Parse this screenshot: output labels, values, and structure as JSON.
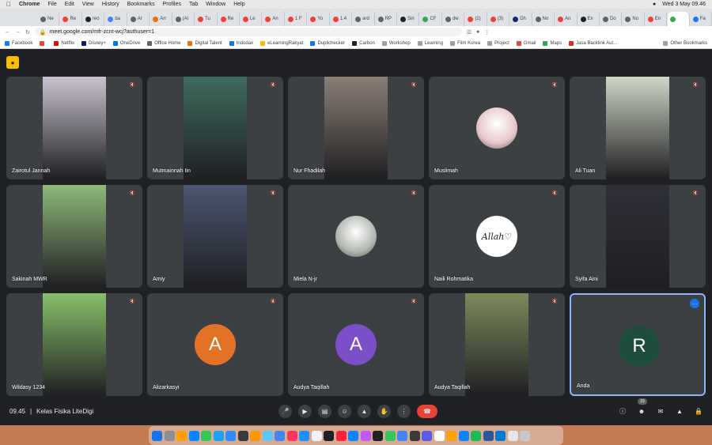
{
  "macos": {
    "app": "Chrome",
    "menus": [
      "File",
      "Edit",
      "View",
      "History",
      "Bookmarks",
      "Profiles",
      "Tab",
      "Window",
      "Help"
    ],
    "clock": "Wed 3 May  09.46"
  },
  "browser": {
    "tabs": [
      {
        "label": "Ne",
        "color": "#5f6368"
      },
      {
        "label": "Re",
        "color": "#ea4335"
      },
      {
        "label": "reo",
        "color": "#202124"
      },
      {
        "label": "ba",
        "color": "#4285f4"
      },
      {
        "label": "Ar",
        "color": "#5f6368"
      },
      {
        "label": "Arr",
        "color": "#e37400"
      },
      {
        "label": "(Al",
        "color": "#5f6368"
      },
      {
        "label": "Tu",
        "color": "#ea4335"
      },
      {
        "label": "Re",
        "color": "#ea4335"
      },
      {
        "label": "Le",
        "color": "#ea4335"
      },
      {
        "label": "An",
        "color": "#ea4335"
      },
      {
        "label": "1 F",
        "color": "#ea4335"
      },
      {
        "label": "Yo",
        "color": "#ea4335"
      },
      {
        "label": "1.4",
        "color": "#ea4335"
      },
      {
        "label": "ard",
        "color": "#5f6368"
      },
      {
        "label": "RP",
        "color": "#5f6368"
      },
      {
        "label": "Sin",
        "color": "#202124"
      },
      {
        "label": "CF",
        "color": "#34a853"
      },
      {
        "label": "dw",
        "color": "#5f6368"
      },
      {
        "label": "(2)",
        "color": "#ea4335"
      },
      {
        "label": "(3)",
        "color": "#ea4335"
      },
      {
        "label": "Dh",
        "color": "#1a237e"
      },
      {
        "label": "No",
        "color": "#5f6368"
      },
      {
        "label": "An",
        "color": "#ea4335"
      },
      {
        "label": "Ex",
        "color": "#202124"
      },
      {
        "label": "Do",
        "color": "#5f6368"
      },
      {
        "label": "No",
        "color": "#5f6368"
      },
      {
        "label": "En",
        "color": "#ea4335"
      },
      {
        "label": "",
        "color": "#34a853",
        "active": true
      },
      {
        "label": "Fa",
        "color": "#1877f2"
      }
    ],
    "url": "meet.google.com/mfr-zcnt-wcj?authuser=1",
    "bookmarks": [
      {
        "label": "Facebook",
        "color": "#1877f2"
      },
      {
        "label": "",
        "color": "#ea4335"
      },
      {
        "label": "Netflix",
        "color": "#e50914"
      },
      {
        "label": "Disney+",
        "color": "#0b1a5a"
      },
      {
        "label": "OneDrive",
        "color": "#0078d4"
      },
      {
        "label": "Office Home",
        "color": "#5f6368"
      },
      {
        "label": "Digital Talent",
        "color": "#e37400"
      },
      {
        "label": "Indodax",
        "color": "#1a73e8"
      },
      {
        "label": "eLearningRakyat",
        "color": "#fbbc04"
      },
      {
        "label": "Duplichecker",
        "color": "#1a73e8"
      },
      {
        "label": "Carbon",
        "color": "#202124"
      },
      {
        "label": "Workshop",
        "color": "#9aa0a6"
      },
      {
        "label": "Learning",
        "color": "#9aa0a6"
      },
      {
        "label": "Film Korea",
        "color": "#9aa0a6"
      },
      {
        "label": "Project",
        "color": "#9aa0a6"
      },
      {
        "label": "Gmail",
        "color": "#ea4335"
      },
      {
        "label": "Maps",
        "color": "#34a853"
      },
      {
        "label": "Jasa Backlink Aut...",
        "color": "#d93025"
      }
    ],
    "other_bookmarks": "Other Bookmarks"
  },
  "meet": {
    "participants": [
      {
        "name": "Zairotul Jannah",
        "kind": "video",
        "bg": "#c9c3cf"
      },
      {
        "name": "Mutmainnah Iin",
        "kind": "video",
        "bg": "#3e6b5e"
      },
      {
        "name": "Nur Fhadilah",
        "kind": "video",
        "bg": "#8b7f76"
      },
      {
        "name": "Muslimah",
        "kind": "photo",
        "bg": "#e6c7c9"
      },
      {
        "name": "Ali Tuan",
        "kind": "video",
        "bg": "#cfd6c6"
      },
      {
        "name": "Sakinah MWR",
        "kind": "video",
        "bg": "#8fb97a"
      },
      {
        "name": "Amiy",
        "kind": "video",
        "bg": "#4a5670"
      },
      {
        "name": "Miela N-jr",
        "kind": "photo",
        "bg": "#b3b7b0"
      },
      {
        "name": "Naili Rohmatika",
        "kind": "allah",
        "bg": "#ffffff"
      },
      {
        "name": "Syifa Aini",
        "kind": "video",
        "bg": "#2f3038"
      },
      {
        "name": "Wildasy 1234",
        "kind": "video",
        "bg": "#88c06a"
      },
      {
        "name": "Alizarkasyi",
        "kind": "letter",
        "letter": "A",
        "bg": "#e37227"
      },
      {
        "name": "Audya Taqillah",
        "kind": "letter",
        "letter": "A",
        "bg": "#7b4fc7"
      },
      {
        "name": "Audya Taqillah",
        "kind": "video",
        "bg": "#7c8a5a"
      },
      {
        "name": "Anda",
        "kind": "letter",
        "letter": "R",
        "bg": "#1e4d3b",
        "self": true
      }
    ],
    "avatar_text": "Allah♡",
    "footer": {
      "time": "09.45",
      "separator": "|",
      "meeting_name": "Kelas Fisika LiteDigi",
      "participant_count": "15"
    }
  },
  "dock": {
    "icons": [
      "#1a73e8",
      "#8e8e93",
      "#ff9f0a",
      "#0a84ff",
      "#34c759",
      "#1da1f2",
      "#2d8cff",
      "#3a3a3c",
      "#ff9500",
      "#5ac8fa",
      "#4285f4",
      "#ff375f",
      "#1e90ff",
      "#f2f2f7",
      "#202124",
      "#fa243c",
      "#0a84ff",
      "#bf5af2",
      "#202124",
      "#34c759",
      "#4285f4",
      "#3a3a3c",
      "#5e5ce6",
      "#ffffff",
      "#ff9f0a",
      "#0a84ff",
      "#1db954",
      "#2b579a",
      "#0078d4",
      "#e5e5ea",
      "#c7c7cc"
    ]
  }
}
